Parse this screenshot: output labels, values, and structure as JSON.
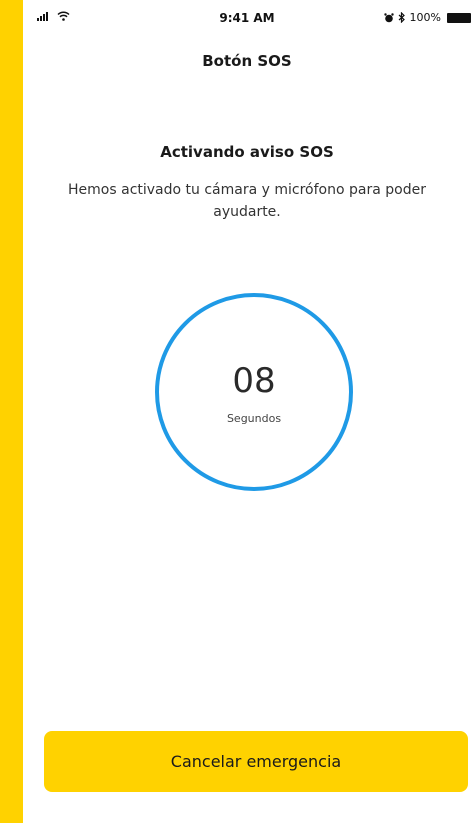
{
  "status_bar": {
    "time": "9:41 AM",
    "battery_percent": "100%",
    "icons": [
      "signal-icon",
      "wifi-icon",
      "alarm-icon",
      "bluetooth-icon",
      "battery-icon"
    ]
  },
  "nav": {
    "title": "Botón SOS"
  },
  "main": {
    "heading": "Activando aviso SOS",
    "description": "Hemos activado tu cámara y micrófono para poder ayudarte.",
    "countdown": {
      "value": "08",
      "unit": "Segundos"
    }
  },
  "actions": {
    "cancel_label": "Cancelar emergencia"
  },
  "colors": {
    "accent_yellow": "#ffd200",
    "timer_ring_blue": "#1f9ae6",
    "background": "#ffffff"
  }
}
